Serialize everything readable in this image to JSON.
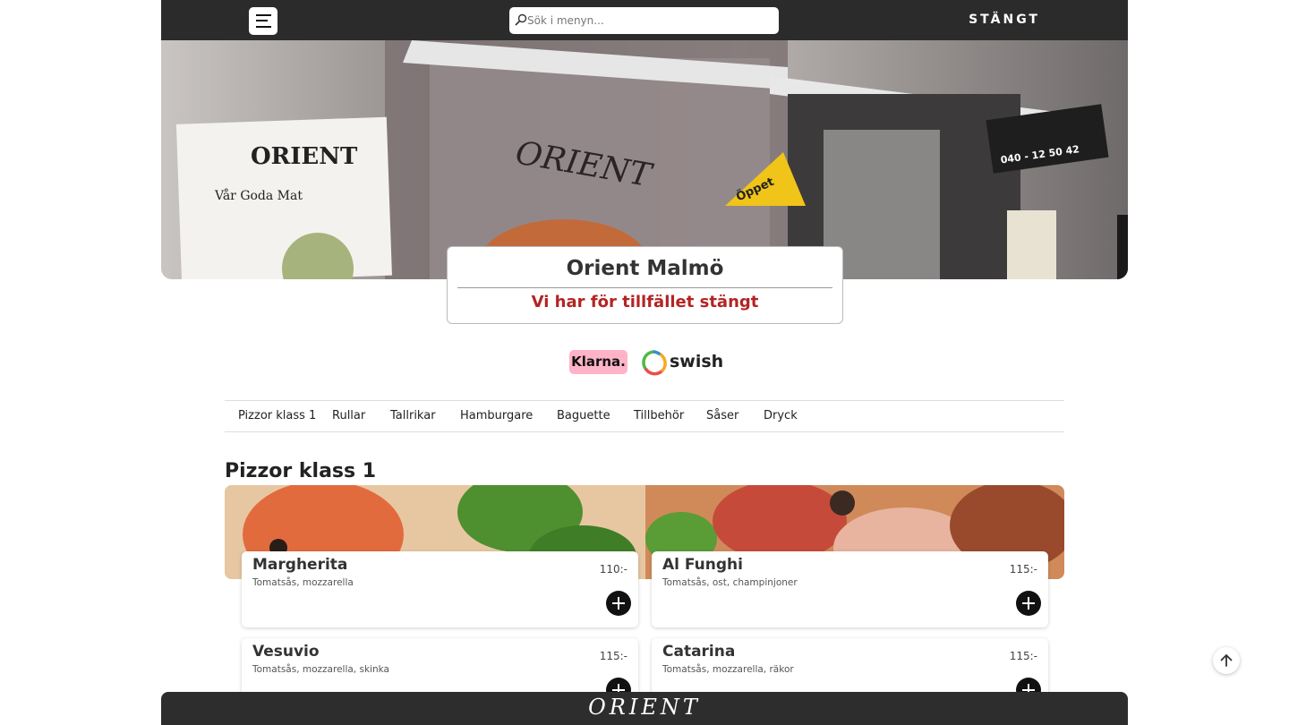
{
  "header": {
    "search_placeholder": "Sök i menyn...",
    "status_label": "STÄNGT"
  },
  "hero": {
    "sign_title": "ORIENT",
    "sign_subtitle": "Vår Goda Mat",
    "window_lettering": "ORIENT",
    "flag_text": "Öppet",
    "phone": "040 - 12 50 42"
  },
  "restaurant": {
    "name": "Orient Malmö",
    "status": "Vi har för tillfället stängt"
  },
  "payments": {
    "klarna": "Klarna.",
    "swish": "swish"
  },
  "categories": [
    {
      "label": "Pizzor klass 1"
    },
    {
      "label": "Rullar"
    },
    {
      "label": "Tallrikar"
    },
    {
      "label": "Hamburgare"
    },
    {
      "label": "Baguette"
    },
    {
      "label": "Tillbehör"
    },
    {
      "label": "Såser"
    },
    {
      "label": "Dryck"
    }
  ],
  "section": {
    "title": "Pizzor klass 1",
    "items": [
      {
        "name": "Margherita",
        "description": "Tomatsås, mozzarella",
        "price": "110:-"
      },
      {
        "name": "Al Funghi",
        "description": "Tomatsås, ost, champinjoner",
        "price": "115:-"
      },
      {
        "name": "Vesuvio",
        "description": "Tomatsås, mozzarella, skinka",
        "price": "115:-"
      },
      {
        "name": "Catarina",
        "description": "Tomatsås, mozzarella, räkor",
        "price": "115:-"
      }
    ]
  },
  "footer": {
    "logo": "ORIENT"
  },
  "colors": {
    "topbar": "#2b2b2b",
    "status_red": "#b32424",
    "klarna_pink": "#ffb3c7"
  }
}
